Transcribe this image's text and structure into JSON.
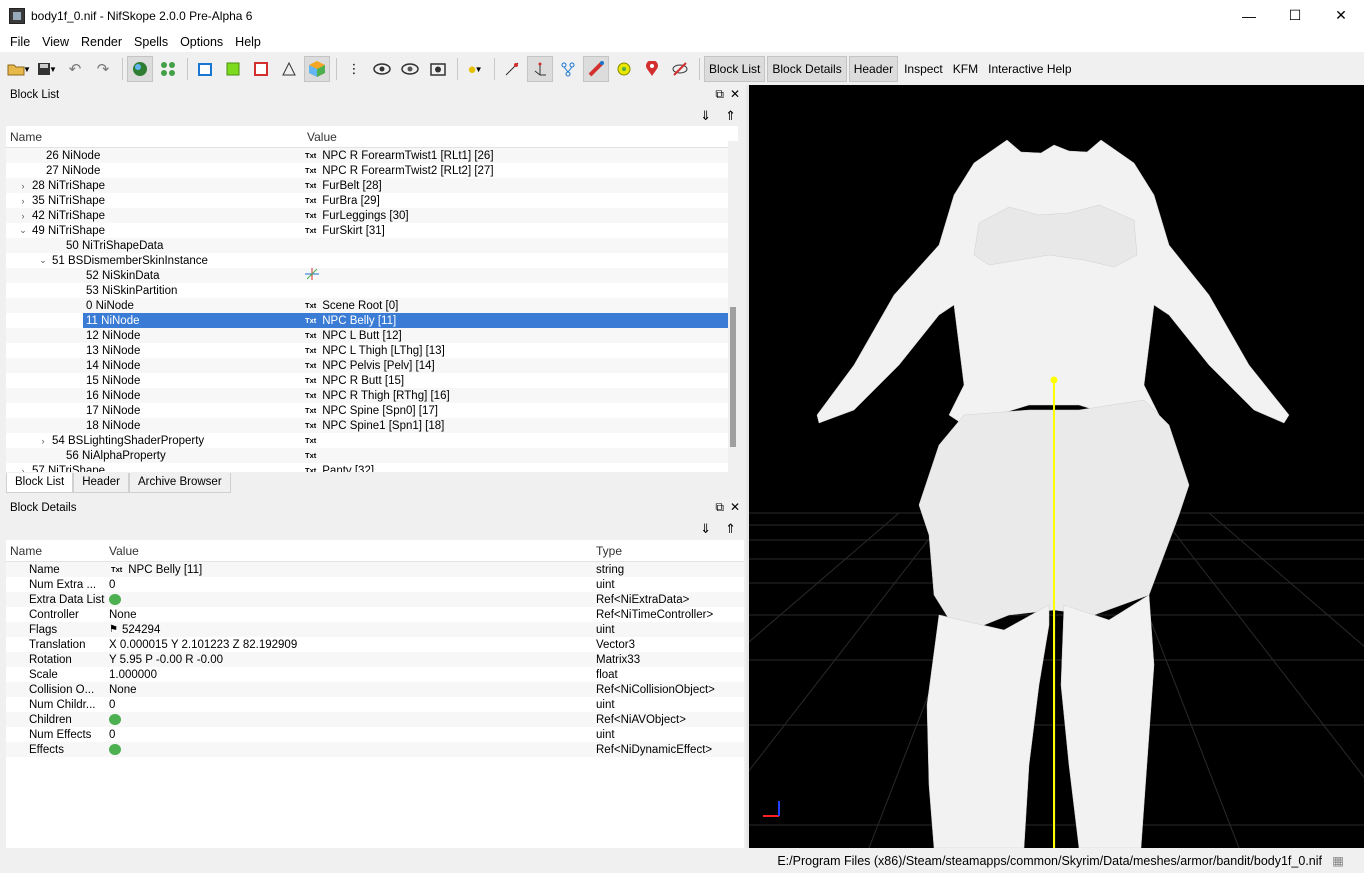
{
  "window": {
    "title": "body1f_0.nif - NifSkope 2.0.0 Pre-Alpha 6"
  },
  "menu": [
    "File",
    "View",
    "Render",
    "Spells",
    "Options",
    "Help"
  ],
  "toolbar": {
    "text_buttons": [
      "Block List",
      "Block Details",
      "Header",
      "Inspect",
      "KFM",
      "Interactive Help"
    ]
  },
  "block_list": {
    "title": "Block List",
    "col_name": "Name",
    "col_value": "Value",
    "rows": [
      {
        "name": "26 NiNode",
        "value": "NPC R ForearmTwist1 [RLt1] [26]"
      },
      {
        "name": "27 NiNode",
        "value": "NPC R ForearmTwist2 [RLt2] [27]"
      },
      {
        "name": "28 NiTriShape",
        "value": "FurBelt [28]"
      },
      {
        "name": "35 NiTriShape",
        "value": "FurBra [29]"
      },
      {
        "name": "42 NiTriShape",
        "value": "FurLeggings [30]"
      },
      {
        "name": "49 NiTriShape",
        "value": "FurSkirt [31]"
      },
      {
        "name": "50 NiTriShapeData",
        "value": ""
      },
      {
        "name": "51 BSDismemberSkinInstance",
        "value": ""
      },
      {
        "name": "52 NiSkinData",
        "value": ""
      },
      {
        "name": "53 NiSkinPartition",
        "value": ""
      },
      {
        "name": "0 NiNode",
        "value": "Scene Root [0]"
      },
      {
        "name": "11 NiNode",
        "value": "NPC Belly [11]"
      },
      {
        "name": "12 NiNode",
        "value": "NPC L Butt [12]"
      },
      {
        "name": "13 NiNode",
        "value": "NPC L Thigh [LThg] [13]"
      },
      {
        "name": "14 NiNode",
        "value": "NPC Pelvis [Pelv] [14]"
      },
      {
        "name": "15 NiNode",
        "value": "NPC R Butt [15]"
      },
      {
        "name": "16 NiNode",
        "value": "NPC R Thigh [RThg] [16]"
      },
      {
        "name": "17 NiNode",
        "value": "NPC Spine [Spn0] [17]"
      },
      {
        "name": "18 NiNode",
        "value": "NPC Spine1 [Spn1] [18]"
      },
      {
        "name": "54 BSLightingShaderProperty",
        "value": ""
      },
      {
        "name": "56 NiAlphaProperty",
        "value": ""
      },
      {
        "name": "57 NiTriShape",
        "value": "Panty [32]"
      }
    ],
    "txt_label": "Txt"
  },
  "bottom_tabs": [
    "Block List",
    "Header",
    "Archive Browser"
  ],
  "block_details": {
    "title": "Block Details",
    "col_name": "Name",
    "col_value": "Value",
    "col_type": "Type",
    "rows": [
      {
        "name": "Name",
        "value": "NPC Belly [11]",
        "type": "string"
      },
      {
        "name": "Num Extra ...",
        "value": "0",
        "type": "uint"
      },
      {
        "name": "Extra Data List",
        "value": "",
        "type": "Ref<NiExtraData>"
      },
      {
        "name": "Controller",
        "value": "None",
        "type": "Ref<NiTimeController>"
      },
      {
        "name": "Flags",
        "value": "524294",
        "type": "uint"
      },
      {
        "name": "Translation",
        "value": "X 0.000015 Y 2.101223 Z 82.192909",
        "type": "Vector3"
      },
      {
        "name": "Rotation",
        "value": "Y 5.95 P -0.00 R -0.00",
        "type": "Matrix33"
      },
      {
        "name": "Scale",
        "value": "1.000000",
        "type": "float"
      },
      {
        "name": "Collision O...",
        "value": "None",
        "type": "Ref<NiCollisionObject>"
      },
      {
        "name": "Num Childr...",
        "value": "0",
        "type": "uint"
      },
      {
        "name": "Children",
        "value": "",
        "type": "Ref<NiAVObject>"
      },
      {
        "name": "Num Effects",
        "value": "0",
        "type": "uint"
      },
      {
        "name": "Effects",
        "value": "",
        "type": "Ref<NiDynamicEffect>"
      }
    ]
  },
  "status": {
    "path": "E:/Program Files (x86)/Steam/steamapps/common/Skyrim/Data/meshes/armor/bandit/body1f_0.nif"
  },
  "colors": {
    "selection": "#3a7bd5",
    "viewport_bg": "#000000",
    "bone_axis": "#ffff00"
  }
}
